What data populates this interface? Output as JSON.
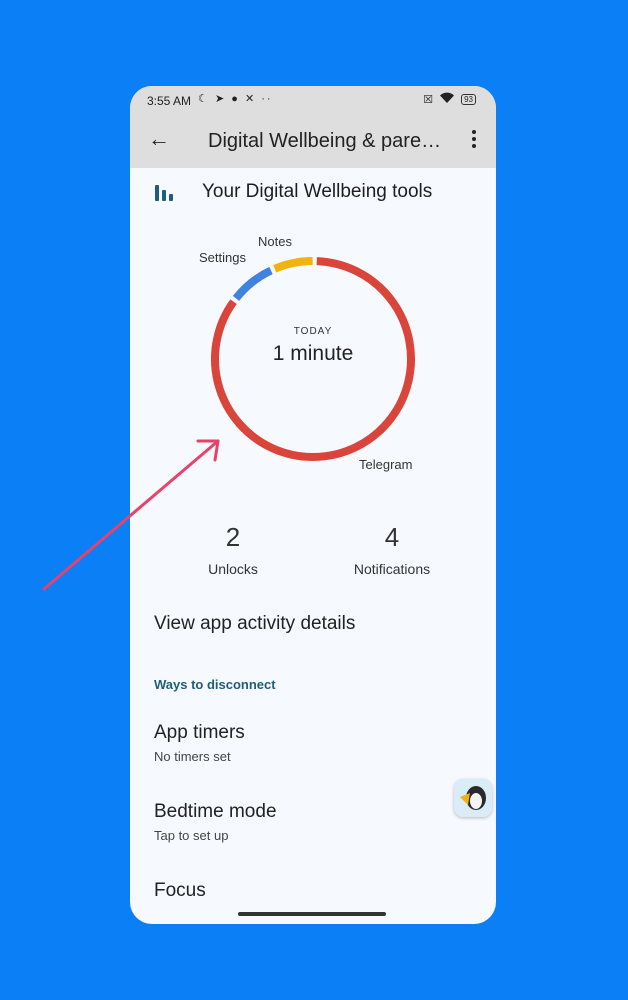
{
  "status_bar": {
    "time": "3:55 AM",
    "left_icons": [
      "moon-icon",
      "telegram-icon",
      "keyhole-icon",
      "x-icon",
      "more-dots-icon"
    ],
    "right_icons": [
      "no-sim-icon",
      "wifi-icon",
      "battery-icon"
    ],
    "battery": "93"
  },
  "app_bar": {
    "title": "Digital Wellbeing & pare…"
  },
  "section": {
    "title": "Your Digital Wellbeing tools"
  },
  "usage_chart": {
    "center_label": "TODAY",
    "center_value": "1 minute"
  },
  "chart_data": {
    "type": "pie",
    "categories": [
      "Telegram",
      "Settings",
      "Notes"
    ],
    "values": [
      85,
      8,
      7
    ],
    "colors": [
      "#d9453a",
      "#3f82e0",
      "#f2b311"
    ]
  },
  "stats": {
    "unlocks_value": "2",
    "unlocks_label": "Unlocks",
    "notifications_value": "4",
    "notifications_label": "Notifications"
  },
  "menu": {
    "view_details": "View app activity details",
    "ways_header": "Ways to disconnect",
    "app_timers_title": "App timers",
    "app_timers_sub": "No timers set",
    "bedtime_title": "Bedtime mode",
    "bedtime_sub": "Tap to set up",
    "focus_title": "Focus"
  },
  "annotation": {
    "arrow_color": "#e8426a"
  },
  "colors": {
    "background": "#0a7ff6",
    "screen": "#f6f9fe",
    "app_bar": "#dedede",
    "accent": "#1f5e7a"
  }
}
